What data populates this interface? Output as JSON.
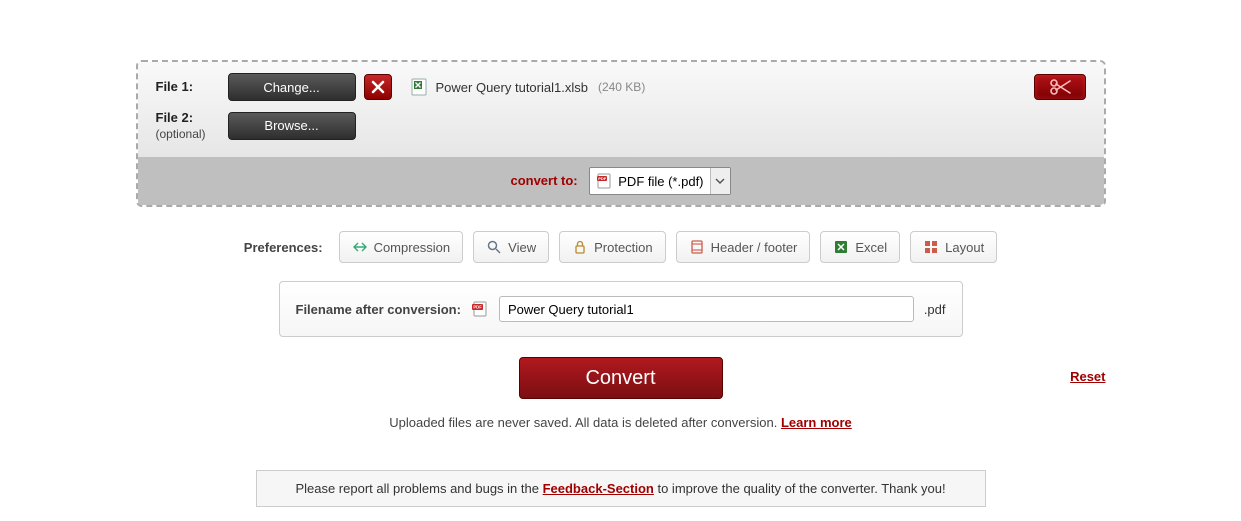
{
  "file1": {
    "label": "File 1:",
    "change_btn": "Change...",
    "filename": "Power Query tutorial1.xlsb",
    "size": "(240 KB)"
  },
  "file2": {
    "label": "File 2:",
    "optional": "(optional)",
    "browse_btn": "Browse..."
  },
  "convert_to": {
    "label": "convert to:",
    "value": "PDF file (*.pdf)"
  },
  "prefs": {
    "label": "Preferences:",
    "items": [
      "Compression",
      "View",
      "Protection",
      "Header / footer",
      "Excel",
      "Layout"
    ]
  },
  "filename_after": {
    "label": "Filename after conversion:",
    "value": "Power Query tutorial1",
    "ext": ".pdf"
  },
  "convert_btn": "Convert",
  "reset": "Reset",
  "notice_a": "Uploaded files are never saved. All data is deleted after conversion. ",
  "notice_link": "Learn more",
  "feedback_a": "Please report all problems and bugs in the ",
  "feedback_link": "Feedback-Section",
  "feedback_b": " to improve the quality of the converter. Thank you!"
}
